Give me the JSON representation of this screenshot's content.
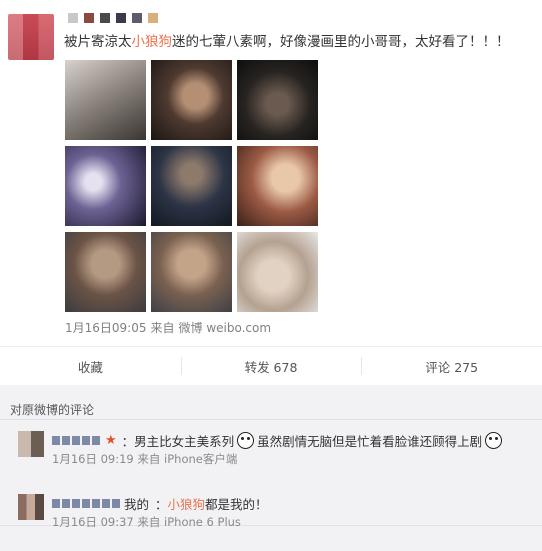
{
  "post": {
    "text_before": "被片寄涼太",
    "text_highlight": "小狼狗",
    "text_after": "迷的七葷八素啊，好像漫画里的小哥哥，太好看了！！！",
    "name_mosaic_colors": [
      "#c8c8c8",
      "#8a4a3c",
      "#4a4a4a",
      "#3a3a48",
      "#5c5c6c",
      "#d8b080"
    ],
    "photos": [
      "photo-1",
      "photo-2",
      "photo-3",
      "photo-4",
      "photo-5",
      "photo-6",
      "photo-7",
      "photo-8",
      "photo-9"
    ],
    "date": "1月16日09:05",
    "source_prefix": "来自",
    "source": "微博 weibo.com"
  },
  "actions": {
    "favorite": "收藏",
    "repost": "转发 678",
    "comment": "评论 275"
  },
  "comments_section": {
    "title": "对原微博的评论",
    "comments": [
      {
        "text_1": "：男主比女主美系列",
        "text_2": "虽然剧情无脑但是忙着看脸谁还顾得上剧",
        "time": "1月16日 09:19 来自 iPhone客户端"
      },
      {
        "name_suffix": "我的",
        "text_prefix": "：",
        "text_highlight": "小狼狗",
        "text_after": "都是我的！",
        "time": "1月16日 09:37 来自 iPhone 6 Plus"
      }
    ]
  },
  "colors": {
    "highlight": "#eb7350",
    "star": "#e5502b",
    "avatar": "#c8404c"
  }
}
